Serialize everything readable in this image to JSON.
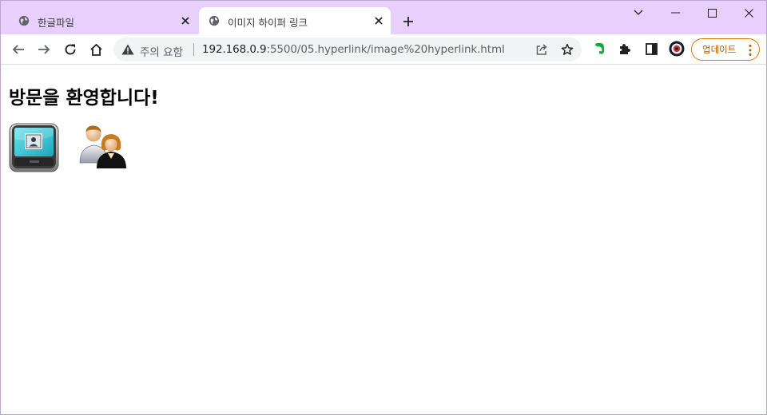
{
  "colors": {
    "tabstrip_bg": "#e8d0fc",
    "accent_update": "#e37400",
    "omnibox_bg": "#f1f3f4"
  },
  "tabs": [
    {
      "title": "한글파일",
      "active": false,
      "favicon": "globe-icon"
    },
    {
      "title": "이미지 하이퍼 링크",
      "active": true,
      "favicon": "globe-icon"
    }
  ],
  "address_bar": {
    "security_text": "주의 요함",
    "url_host": "192.168.0.9",
    "url_rest": ":5500/05.hyperlink/image%20hyperlink.html"
  },
  "toolbar": {
    "update_label": "업데이트"
  },
  "page": {
    "heading": "방문을 환영합니다!",
    "image_links": [
      {
        "name": "monitor-image",
        "icon": "computer-monitor-icon"
      },
      {
        "name": "users-image",
        "icon": "users-icon"
      }
    ]
  }
}
